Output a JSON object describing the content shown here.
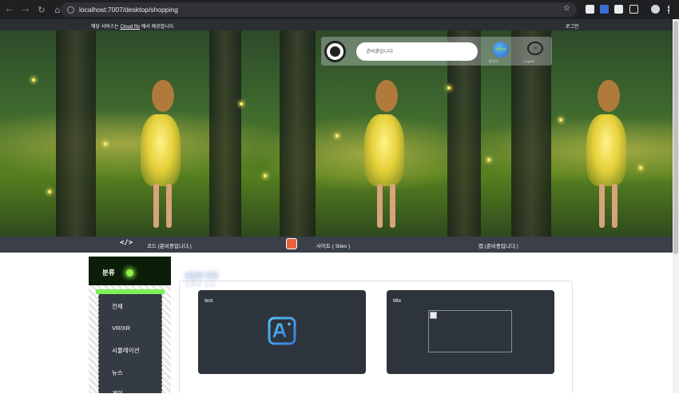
{
  "browser": {
    "url": "localhost:7007/desktop/shopping"
  },
  "topbar": {
    "notice_prefix": "해당 서비스는 ",
    "notice_link": "Cloud Rx",
    "notice_suffix": " 에서 제공합니다.",
    "login": "로그인"
  },
  "search": {
    "placeholder": "준비중입니다.",
    "globe_label": "한국어",
    "lang_label": "English"
  },
  "categories": {
    "code": "코드 (준비중입니다.)",
    "sites": "사이트 ( Sites )",
    "apps": "앱 (준비중입니다.)"
  },
  "sidebar": {
    "title": "분류",
    "items": [
      {
        "label": "전체"
      },
      {
        "label": "VR/XR"
      },
      {
        "label": "시뮬레이션"
      },
      {
        "label": "뉴스"
      },
      {
        "label": "게임"
      }
    ]
  },
  "recommend": {
    "title": "오늘의 추천",
    "cards": [
      {
        "title": "test"
      },
      {
        "title": "title"
      }
    ]
  },
  "colors": {
    "chip_glow": "#8ff04a",
    "card_bg": "#2e343c",
    "catbar_bg": "#3a3f48"
  }
}
